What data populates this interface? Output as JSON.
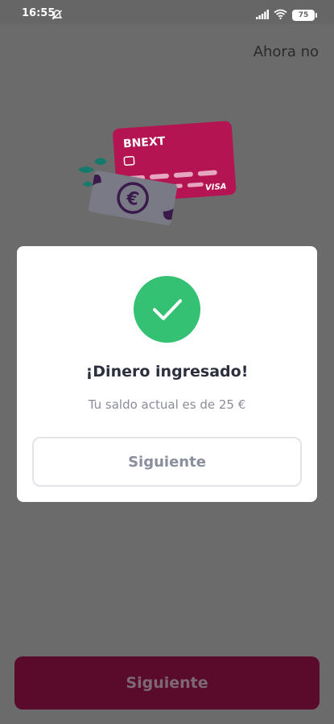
{
  "status_bar": {
    "time": "16:55",
    "battery": "75",
    "icons": [
      "dnd-off-icon",
      "signal-icon",
      "wifi-icon",
      "battery-icon"
    ]
  },
  "header": {
    "skip_label": "Ahora no"
  },
  "illustration": {
    "card_brand": "BNEXT",
    "card_network": "VISA",
    "currency_symbol": "€"
  },
  "modal": {
    "icon": "check-icon",
    "title": "¡Dinero ingresado!",
    "message": "Tu saldo actual es de 25 €",
    "button_label": "Siguiente"
  },
  "footer": {
    "button_label": "Siguiente"
  },
  "colors": {
    "overlay": "#6b6b6b",
    "success": "#34c173",
    "brand_primary": "#5a0a2b",
    "card": "#d0165f"
  }
}
